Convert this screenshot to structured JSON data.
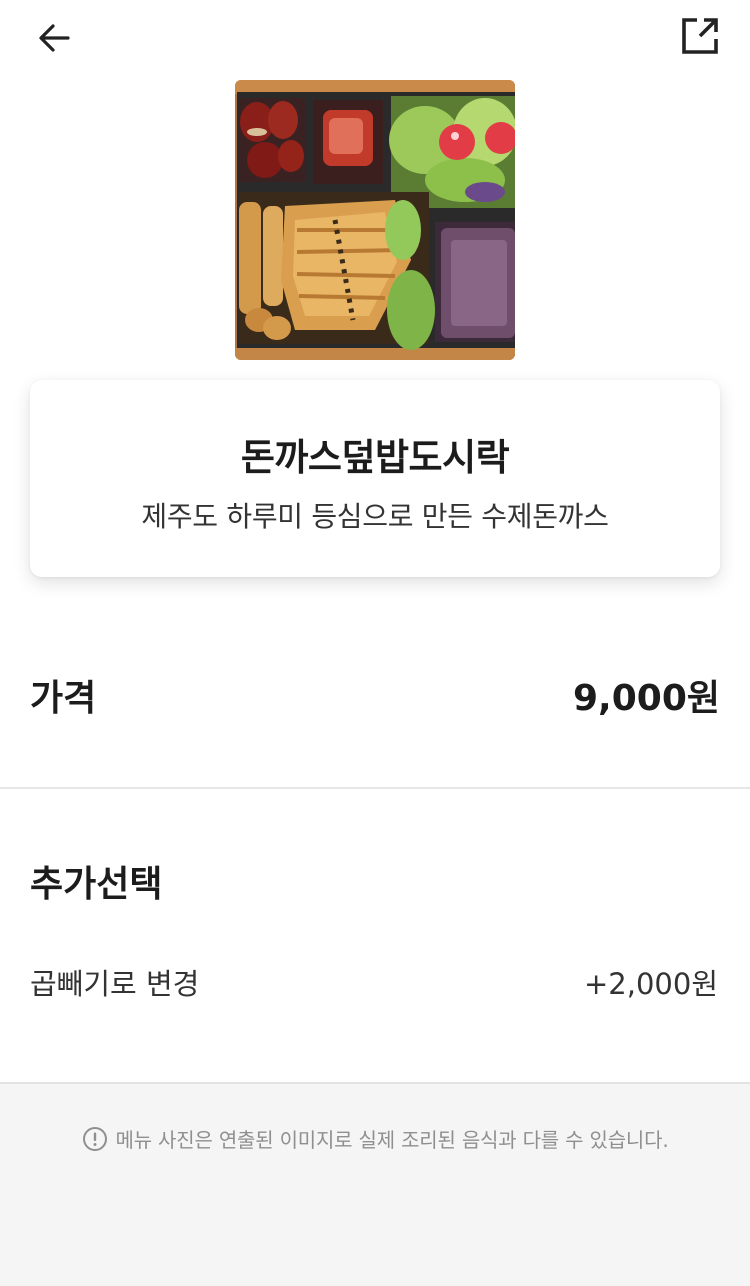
{
  "header": {
    "back_icon": "arrow-left-icon",
    "share_icon": "share-external-icon"
  },
  "menu": {
    "image_icon": "food-photo",
    "title": "돈까스덮밥도시락",
    "subtitle": "제주도 하루미 등심으로 만든 수제돈까스"
  },
  "price": {
    "label": "가격",
    "value": "9,000원"
  },
  "options": {
    "heading": "추가선택",
    "items": [
      {
        "name": "곱빼기로 변경",
        "price": "+2,000원"
      }
    ]
  },
  "footer": {
    "notice_icon": "info-circle-icon",
    "notice": "메뉴 사진은 연출된 이미지로 실제 조리된 음식과 다를 수 있습니다."
  }
}
